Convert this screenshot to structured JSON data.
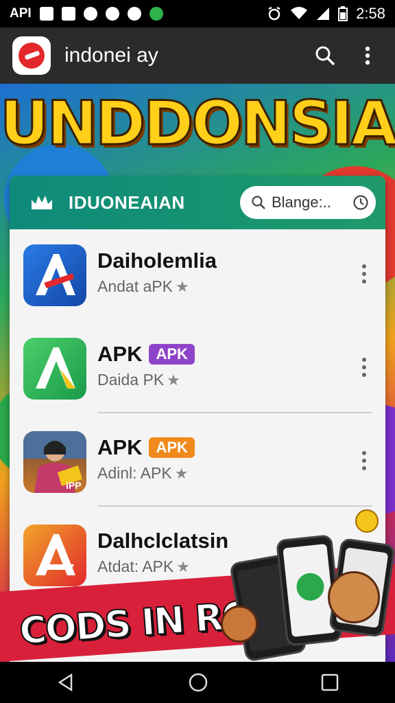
{
  "status": {
    "left_text": "API",
    "time": "2:58"
  },
  "appbar": {
    "title": "indonei ay"
  },
  "banner": {
    "headline": "UNDDONSIA",
    "footer_text": "CODS IN ROW"
  },
  "card": {
    "title": "IDUONEAIAN",
    "search_value": "Blange:.."
  },
  "apps": [
    {
      "name": "Daiholemlia",
      "badge": "",
      "subtitle": "Andat aPK",
      "star": "★"
    },
    {
      "name": "APK",
      "badge": "APK",
      "subtitle": "Daida PK",
      "star": "★"
    },
    {
      "name": "APK",
      "badge": "APK",
      "subtitle": "Adinl: APK",
      "star": "★"
    },
    {
      "name": "Dalhclclatsin",
      "badge": "",
      "subtitle": "Atdat: APK",
      "star": "★"
    }
  ],
  "colors": {
    "header_teal": "#0e8a7a",
    "badge_purple": "#8e44c9",
    "badge_orange": "#f08a1c",
    "headline_yellow": "#ffcf1a",
    "strip_red": "#d8203a"
  }
}
